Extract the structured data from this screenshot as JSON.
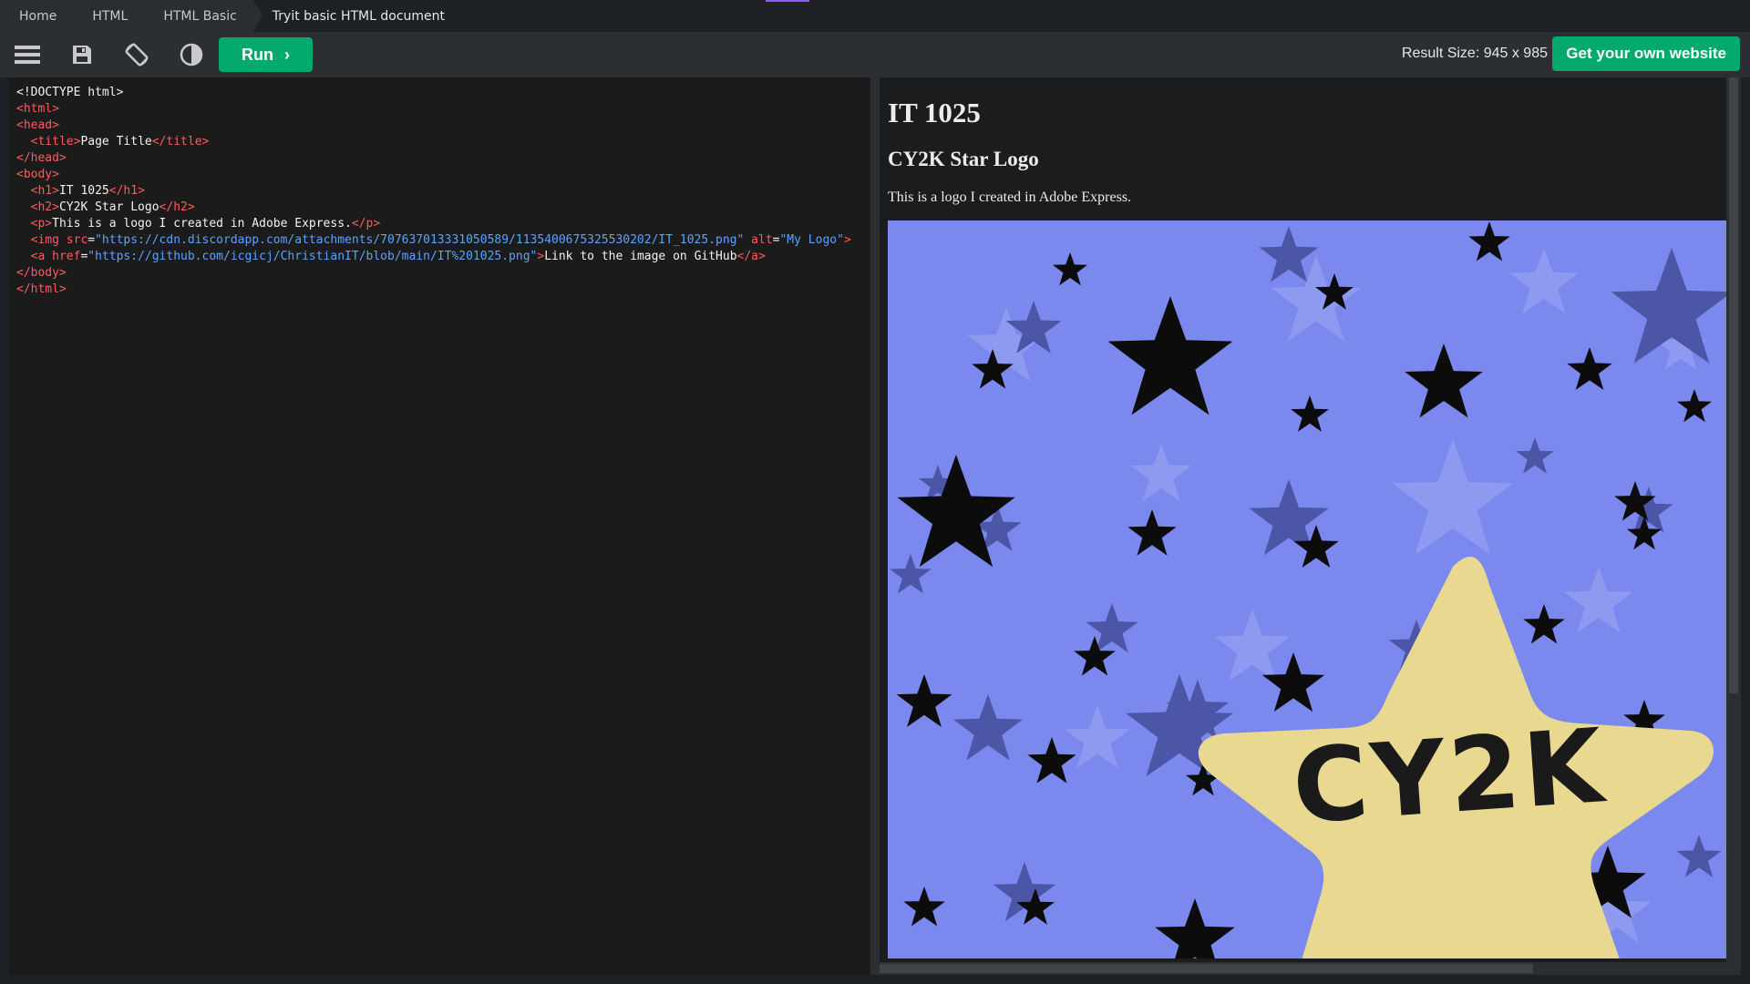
{
  "breadcrumb": [
    "Home",
    "HTML",
    "HTML Basic",
    "Tryit basic HTML document"
  ],
  "toolbar": {
    "menu_icon": "menu-icon",
    "save_icon": "save-icon",
    "rotate_icon": "rotate-icon",
    "theme_icon": "contrast-icon",
    "run_label": "Run",
    "result_size": "Result Size: 945 x 985",
    "get_website_label": "Get your own website"
  },
  "result": {
    "h1": "IT 1025",
    "h2": "CY2K Star Logo",
    "p": "This is a logo I created in Adobe Express.",
    "logo_text": "CY2K",
    "logo_bg_color": "#7b88ee",
    "logo_star_color": "#e8d890"
  },
  "colors": {
    "accent_green": "#04aa6d",
    "tag_red": "#ff5a5a",
    "value_blue": "#5aa2ff"
  }
}
